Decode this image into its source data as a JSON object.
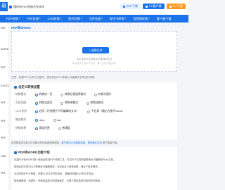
{
  "header": {
    "logo_text": "迅",
    "tagline": "懂你的PDF转换合作伙伴",
    "actions": [
      {
        "label": "APP下载",
        "icon": "phone-icon"
      },
      {
        "label": "PC客户端",
        "icon": "desktop-icon"
      },
      {
        "label": "VIP下载",
        "icon": "crown-icon"
      }
    ]
  },
  "nav": {
    "items": [
      "PDF转换",
      "PDF处理",
      "CAD转换",
      "图片转换",
      "文件压缩",
      "电子书转换",
      "音视频转换",
      "客户端下载"
    ]
  },
  "sidebar": {
    "items": [
      "PDF",
      "WORD",
      "PPT",
      "EXCEL",
      "PDF",
      "PDF",
      "PDF",
      "CAD",
      "PDF"
    ]
  },
  "page": {
    "title": "PDF转WORD"
  },
  "upload": {
    "button": "+ 选择文件",
    "hint": "点击选择文件或将文件拖拽到此处",
    "hint2": "单次最多上传10个文件，每个文件不超过2M"
  },
  "note": "注意：如果PDF文件为扫描件，请先使用PDF转换为可编辑文字再进行转换",
  "settings": {
    "title": "自定义转换设置",
    "rows": [
      {
        "label": "转换模式",
        "options": [
          {
            "text": "转换成一页",
            "selected": true
          },
          {
            "text": "转换后保留原格式",
            "selected": false
          },
          {
            "text": "转换为图片",
            "selected": false
          }
        ]
      },
      {
        "label": "页码范围",
        "options": [
          {
            "text": "转换全部页",
            "selected": true
          },
          {
            "text": "转换单数页",
            "selected": false
          },
          {
            "text": "转换双数页",
            "selected": false
          }
        ]
      },
      {
        "label": "OCR识别",
        "options": [
          {
            "text": "启用（识别图片中可编辑的文字）",
            "selected": true
          },
          {
            "text": "不启用（输出为图片Word）",
            "selected": false
          }
        ]
      },
      {
        "label": "输出格式",
        "options": [
          {
            "text": "docx",
            "selected": true
          },
          {
            "text": "doc",
            "selected": false
          }
        ]
      },
      {
        "label": "转换效果",
        "options": [
          {
            "text": "高度还原",
            "selected": true
          },
          {
            "text": "普通版",
            "selected": false
          }
        ]
      }
    ]
  },
  "tip": {
    "prefix": "您未登录或当前文件已超出在线免费转换范围，",
    "link": "客户端可以无限制转换，更多格式支持",
    "suffix": " 请下载客户端。"
  },
  "intro": {
    "title": "PDF转WORD功能介绍",
    "lines": [
      "迅捷PDF转WORD是一款免费在线PDF转换工具，可将PDF文档完整转换为可编辑的Word文档，",
      "转换后的文档可以方便地进行编辑修改，支持自定义转换设置，满足个性化需求。",
      "支持扫描件PDF转换，内置OCR文字识别技术，准确识别图片中的文字内容，",
      "转换速度快、效果好，完美保留原文档排版格式，无需下载安装任何软件即可使用。"
    ]
  }
}
